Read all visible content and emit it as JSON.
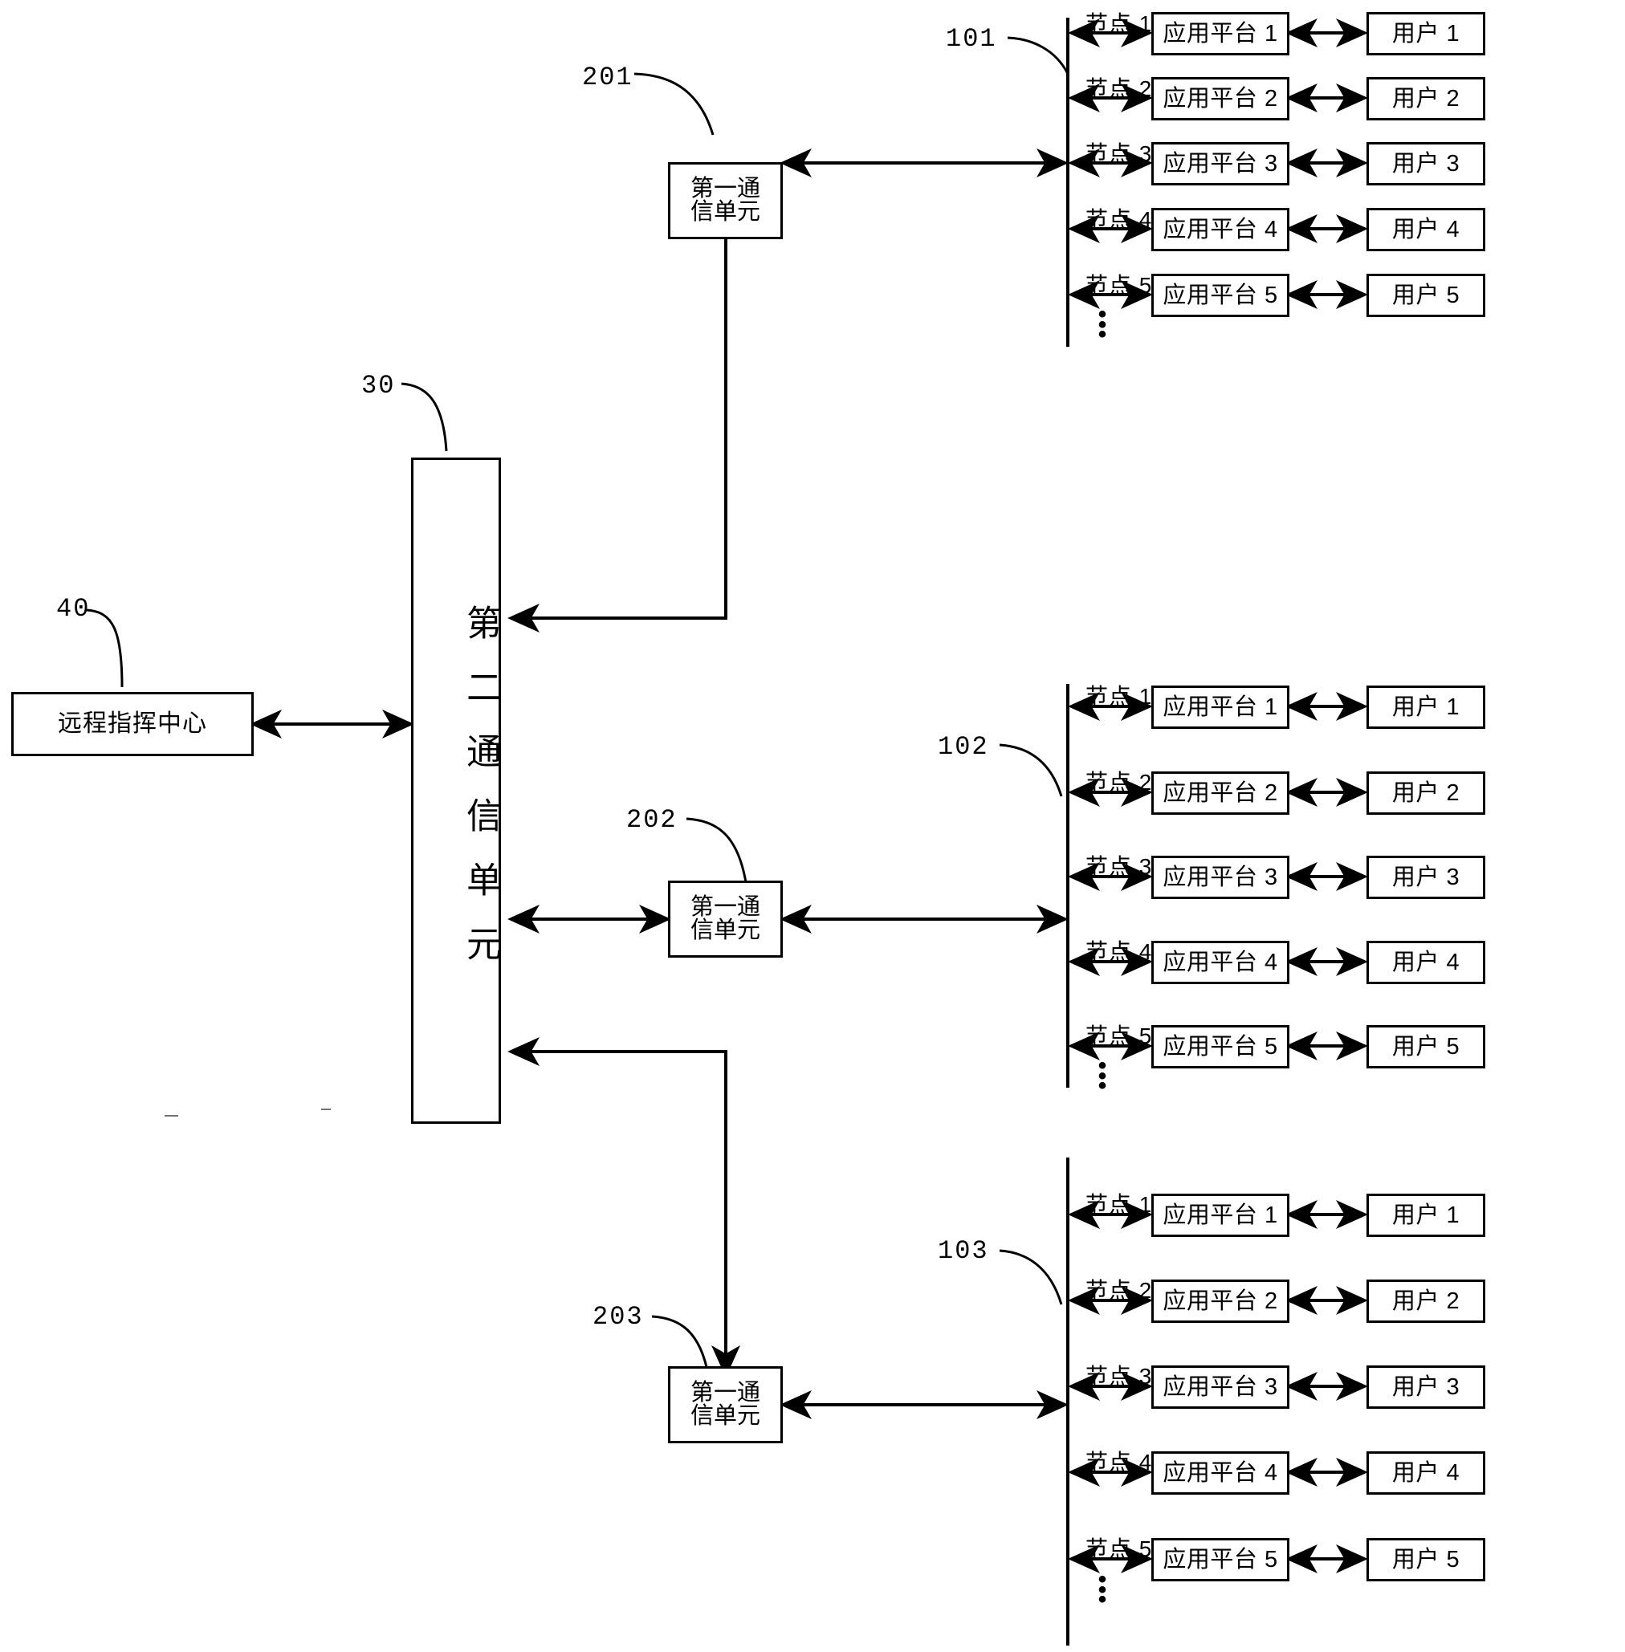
{
  "diagram": {
    "title_present": false,
    "refs": {
      "group1": "101",
      "group2": "102",
      "group3": "103",
      "fcu1": "201",
      "fcu2": "202",
      "fcu3": "203",
      "scu": "30",
      "rcc": "40"
    },
    "labels": {
      "first_comm_unit_line1": "第一通",
      "first_comm_unit_line2": "信单元",
      "second_comm_unit": "第二通信单元",
      "remote_command_center": "远程指挥中心",
      "ellipsis_dot": "•"
    },
    "node_labels": [
      "节点 1",
      "节点 2",
      "节点 3",
      "节点 4",
      "节点 5"
    ],
    "app_platforms": [
      "应用平台 1",
      "应用平台 2",
      "应用平台 3",
      "应用平台 4",
      "应用平台 5"
    ],
    "users": [
      "用户 1",
      "用户 2",
      "用户 3",
      "用户 4",
      "用户 5"
    ],
    "groups": [
      {
        "ref": "101",
        "nodes": [
          "节点 1",
          "节点 2",
          "节点 3",
          "节点 4",
          "节点 5"
        ],
        "platforms": [
          "应用平台 1",
          "应用平台 2",
          "应用平台 3",
          "应用平台 4",
          "应用平台 5"
        ],
        "users": [
          "用户 1",
          "用户 2",
          "用户 3",
          "用户 4",
          "用户 5"
        ]
      },
      {
        "ref": "102",
        "nodes": [
          "节点 1",
          "节点 2",
          "节点 3",
          "节点 4",
          "节点 5"
        ],
        "platforms": [
          "应用平台 1",
          "应用平台 2",
          "应用平台 3",
          "应用平台 4",
          "应用平台 5"
        ],
        "users": [
          "用户 1",
          "用户 2",
          "用户 3",
          "用户 4",
          "用户 5"
        ]
      },
      {
        "ref": "103",
        "nodes": [
          "节点 1",
          "节点 2",
          "节点 3",
          "节点 4",
          "节点 5"
        ],
        "platforms": [
          "应用平台 1",
          "应用平台 2",
          "应用平台 3",
          "应用平台 4",
          "应用平台 5"
        ],
        "users": [
          "用户 1",
          "用户 2",
          "用户 3",
          "用户 4",
          "用户 5"
        ]
      }
    ],
    "colors": {
      "line": "#000000",
      "background": "#ffffff",
      "text": "#000000"
    }
  }
}
